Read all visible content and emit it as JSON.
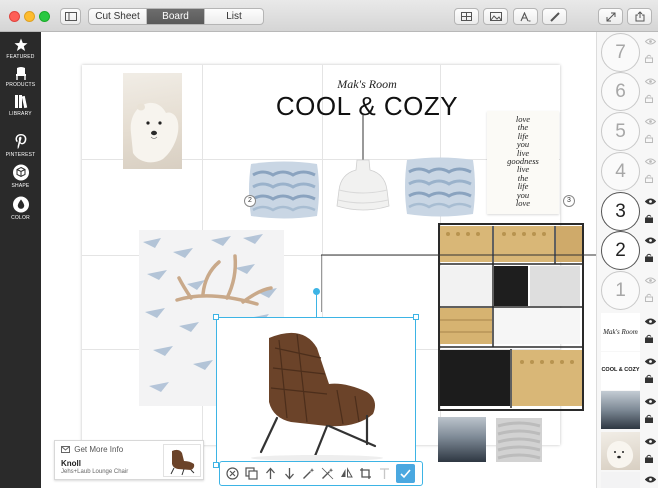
{
  "titlebar": {
    "tabs": [
      {
        "label": "Cut Sheet",
        "active": false
      },
      {
        "label": "Board",
        "active": true
      },
      {
        "label": "List",
        "active": false
      }
    ]
  },
  "sidebar": {
    "items": [
      {
        "label": "FEATURED",
        "icon": "star-icon"
      },
      {
        "label": "PRODUCTS",
        "icon": "chair-icon"
      },
      {
        "label": "LIBRARY",
        "icon": "books-icon"
      },
      {
        "label": "PINTEREST",
        "icon": "pinterest-icon"
      },
      {
        "label": "SHAPE",
        "icon": "cube-icon"
      },
      {
        "label": "COLOR",
        "icon": "drop-icon"
      }
    ]
  },
  "board": {
    "subtitle": "Mak's Room",
    "title": "COOL & COZY",
    "callout_left": "2",
    "callout_right": "3",
    "print_lines": [
      "love",
      "the",
      "life",
      "you",
      "live",
      "goodness",
      "live",
      "the",
      "life",
      "you",
      "love"
    ]
  },
  "layers": {
    "numbers": [
      "7",
      "6",
      "5",
      "4",
      "3",
      "2",
      "1"
    ],
    "active_numbers": [
      "3",
      "2"
    ],
    "thumb_subtitle": "Mak's Room",
    "thumb_title": "COOL & COZY"
  },
  "info": {
    "get_more": "Get More Info",
    "brand": "Knoll",
    "product": "Jehs+Laub Lounge Chair"
  },
  "colors": {
    "selection": "#3db4e5",
    "sidebar_bg": "#2a2a2a",
    "confirm": "#4aa8e0"
  }
}
